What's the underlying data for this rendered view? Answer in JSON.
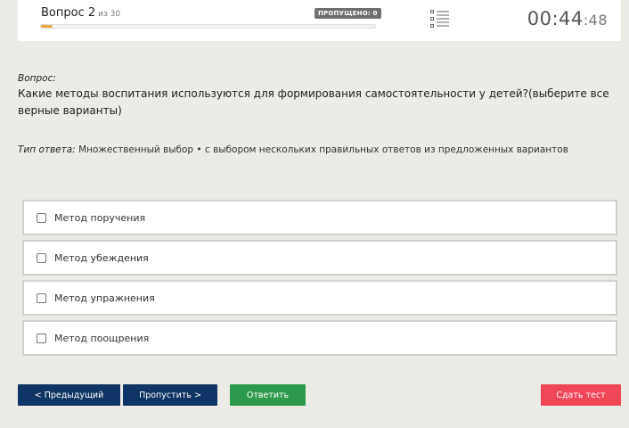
{
  "header": {
    "question_label": "Вопрос 2",
    "question_of": "из 30",
    "skipped_badge": "ПРОПУЩЕНО: 0",
    "progress": 0.034,
    "timer_main": "00:44",
    "timer_seconds_sep": ":",
    "timer_seconds": "48",
    "list_icon": "list-icon"
  },
  "question": {
    "label": "Вопрос:",
    "text": "Какие методы воспитания используются для формирования самостоятельности у детей?(выберите все верные варианты)"
  },
  "answer_type": {
    "label": "Тип ответа:",
    "value": "Множественный выбор • с выбором нескольких правильных ответов из предложенных вариантов"
  },
  "options": [
    {
      "label": "Метод поручения",
      "checked": false
    },
    {
      "label": "Метод убеждения",
      "checked": false
    },
    {
      "label": "Метод упражнения",
      "checked": false
    },
    {
      "label": "Метод поощрения",
      "checked": false
    }
  ],
  "buttons": {
    "prev": "< Предыдущий",
    "skip": "Пропустить >",
    "answer": "Ответить",
    "submit": "Сдать тест"
  },
  "colors": {
    "nav_button": "#0f3466",
    "answer_button": "#2e9a4e",
    "submit_button": "#ef4758",
    "progress": "#e8a93a"
  }
}
